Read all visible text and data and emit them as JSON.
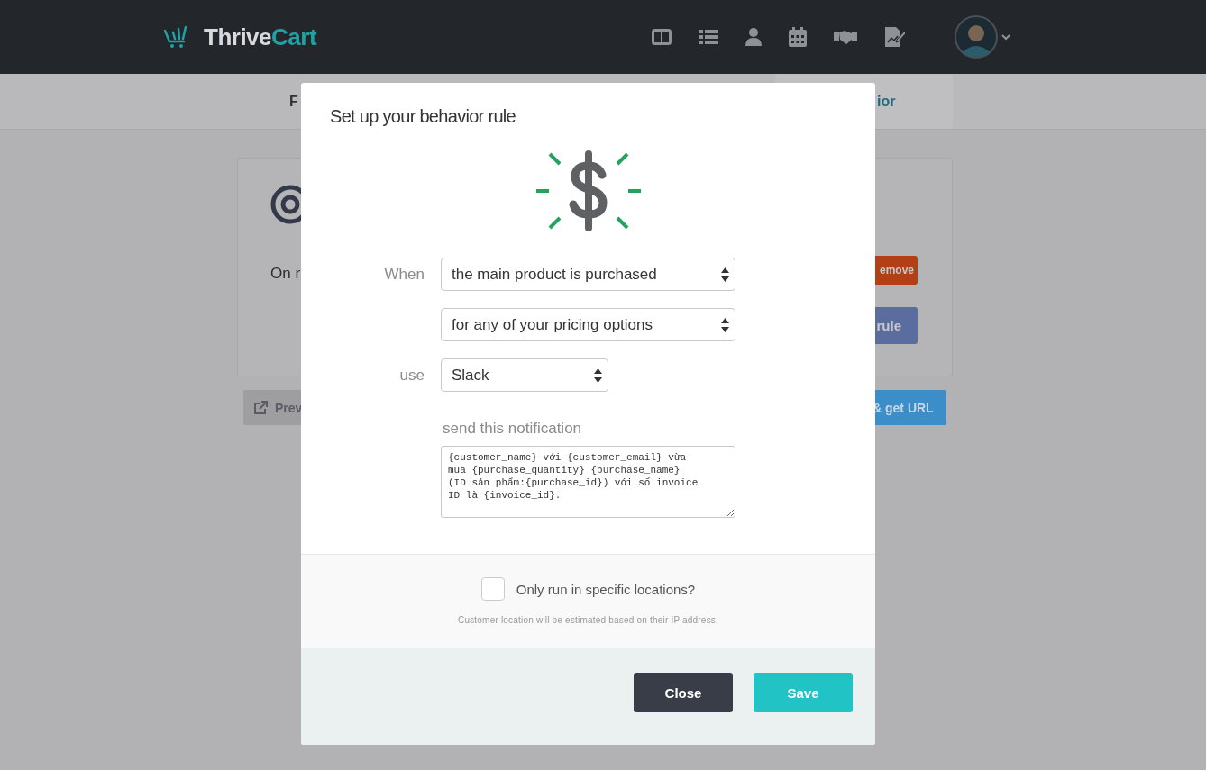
{
  "header": {
    "logo": [
      "Thrive",
      "Cart"
    ]
  },
  "tabs": [
    {
      "label": "F",
      "selected": false
    },
    {
      "label": "ior",
      "selected": true
    }
  ],
  "card": {
    "text": "On r",
    "buttons": [
      {
        "label": "emove",
        "kind": "danger"
      },
      {
        "label": "rule",
        "kind": "primary"
      }
    ]
  },
  "actions": [
    {
      "label": "Prev",
      "kind": "preview"
    },
    {
      "label": "& get URL",
      "kind": "publish"
    }
  ],
  "modal": {
    "title": "Set up your behavior rule",
    "fields": [
      {
        "label": "When",
        "value": "the main product is purchased",
        "kind": "wide"
      },
      {
        "value": "for any of your pricing options",
        "kind": "wide"
      },
      {
        "label": "use",
        "value": "Slack",
        "kind": "narrow"
      }
    ],
    "notification": {
      "label": "send this notification",
      "value": "{customer_name} với {customer_email} vừa\nmua {purchase_quantity} {purchase_name}\n(ID sản phẩm:{purchase_id}) với số invoice\nID là {invoice_id}."
    },
    "location": {
      "label": "Only run in specific locations?",
      "checked": false,
      "hint": "Customer location will be estimated based on their IP address."
    },
    "buttons": [
      {
        "label": "Close",
        "kind": "secondary"
      },
      {
        "label": "Save",
        "kind": "primary"
      }
    ]
  }
}
